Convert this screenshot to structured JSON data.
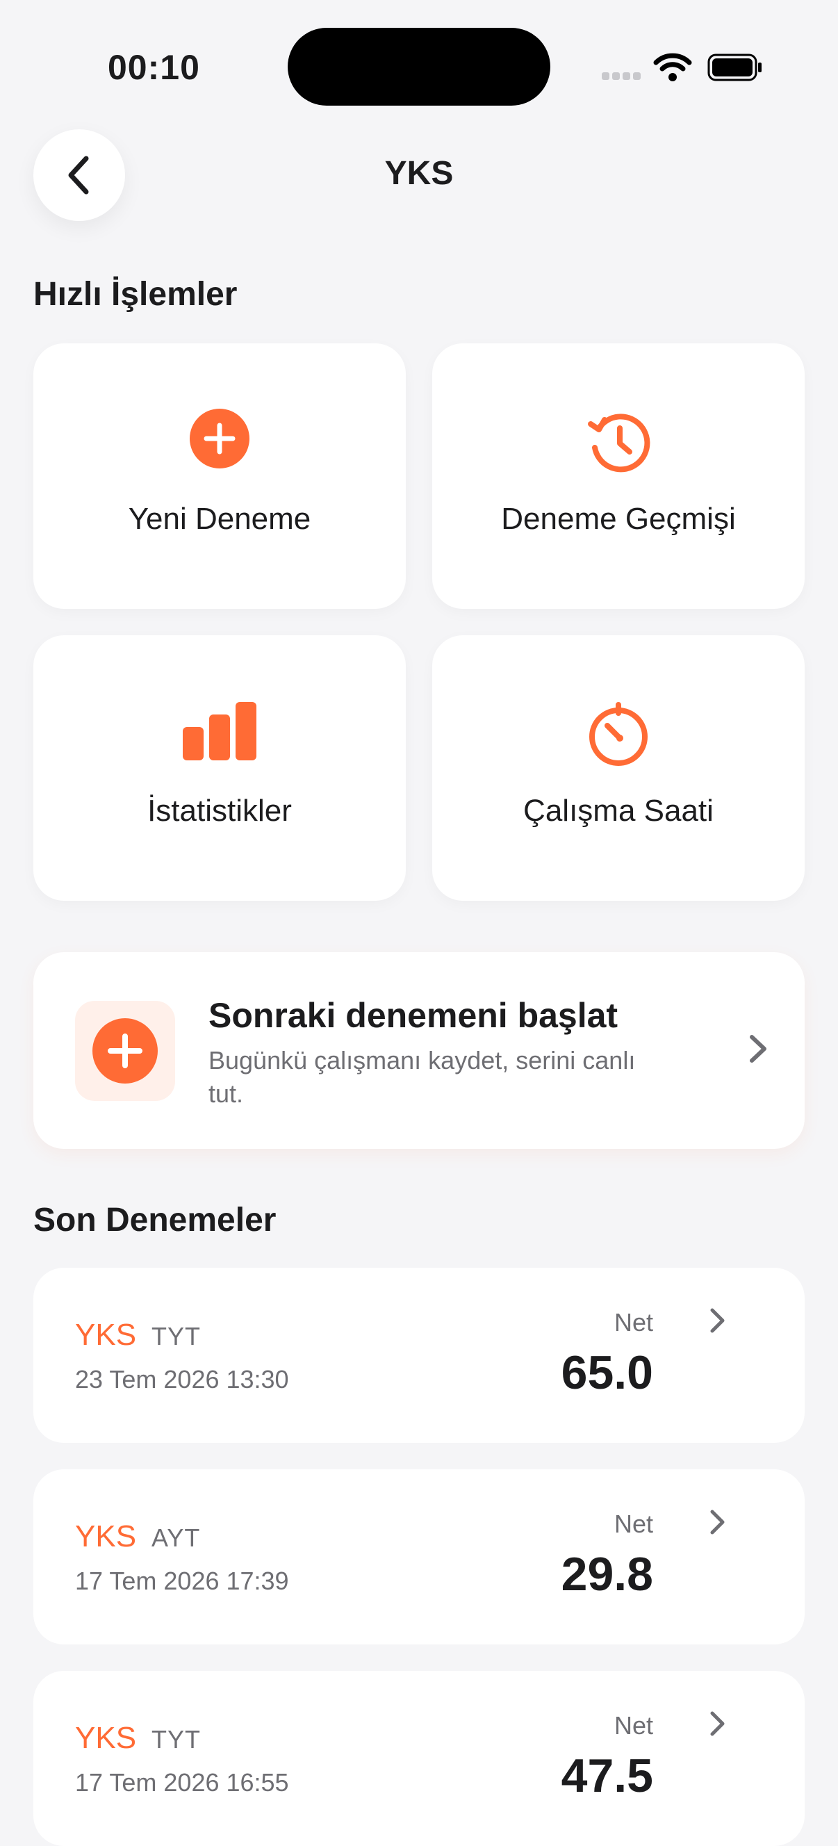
{
  "status_bar": {
    "time": "00:10"
  },
  "header": {
    "title": "YKS"
  },
  "quick_actions": {
    "title": "Hızlı İşlemler",
    "items": [
      {
        "label": "Yeni Deneme",
        "icon": "plus-circle-icon"
      },
      {
        "label": "Deneme Geçmişi",
        "icon": "history-clock-icon"
      },
      {
        "label": "İstatistikler",
        "icon": "bar-chart-icon"
      },
      {
        "label": "Çalışma Saati",
        "icon": "timer-icon"
      }
    ]
  },
  "cta": {
    "title": "Sonraki denemeni başlat",
    "subtitle": "Bugünkü çalışmanı kaydet, serini canlı tut.",
    "icon": "plus-circle-icon"
  },
  "recent": {
    "title": "Son Denemeler",
    "items": [
      {
        "name": "YKS",
        "type": "TYT",
        "date": "23 Tem 2026 13:30",
        "net_label": "Net",
        "net": "65.0"
      },
      {
        "name": "YKS",
        "type": "AYT",
        "date": "17 Tem 2026 17:39",
        "net_label": "Net",
        "net": "29.8"
      },
      {
        "name": "YKS",
        "type": "TYT",
        "date": "17 Tem 2026 16:55",
        "net_label": "Net",
        "net": "47.5"
      }
    ]
  },
  "colors": {
    "accent": "#ff6b35",
    "background": "#f5f5f7",
    "card": "#ffffff",
    "secondary_text": "#6e6e73"
  }
}
